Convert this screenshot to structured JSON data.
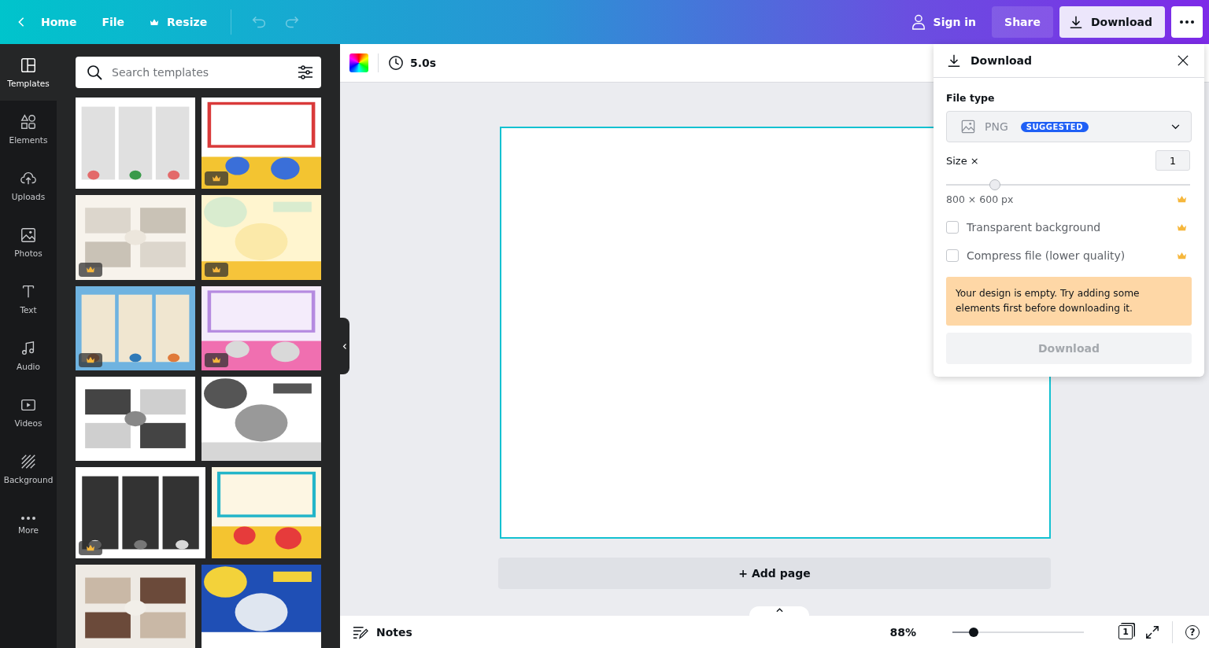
{
  "topbar": {
    "home": "Home",
    "file": "File",
    "resize": "Resize",
    "undo_disabled": true,
    "redo_disabled": true,
    "sign_in": "Sign in",
    "share": "Share",
    "download": "Download"
  },
  "sidebar": {
    "items": [
      {
        "label": "Templates",
        "selected": true
      },
      {
        "label": "Elements",
        "selected": false
      },
      {
        "label": "Uploads",
        "selected": false
      },
      {
        "label": "Photos",
        "selected": false
      },
      {
        "label": "Text",
        "selected": false
      },
      {
        "label": "Audio",
        "selected": false
      },
      {
        "label": "Videos",
        "selected": false
      },
      {
        "label": "Background",
        "selected": false
      },
      {
        "label": "More",
        "selected": false
      }
    ]
  },
  "templates_panel": {
    "search": {
      "placeholder": "Search templates"
    },
    "rows": [
      {
        "items": [
          {
            "kind": "picture",
            "premium": false
          },
          {
            "kind": "picture",
            "premium": true
          }
        ]
      },
      {
        "items": [
          {
            "kind": "picture",
            "premium": true
          },
          {
            "kind": "picture",
            "premium": true
          }
        ]
      },
      {
        "items": [
          {
            "kind": "picture",
            "premium": true
          },
          {
            "kind": "picture",
            "premium": true
          }
        ]
      },
      {
        "items": [
          {
            "kind": "picture",
            "premium": false
          },
          {
            "kind": "picture",
            "premium": false
          }
        ]
      },
      {
        "items": [
          {
            "kind": "picture",
            "premium": true
          },
          {
            "kind": "picture",
            "premium": false
          }
        ]
      },
      {
        "items": [
          {
            "kind": "picture",
            "premium": false
          },
          {
            "kind": "picture",
            "premium": false
          }
        ]
      }
    ]
  },
  "editor_toolbar": {
    "duration": "5.0s"
  },
  "canvas": {
    "add_page": "+ Add page"
  },
  "bottom_bar": {
    "notes": "Notes",
    "zoom": "88%",
    "zoom_slider": {
      "level": 0.16
    },
    "page_count": "1",
    "help": "?"
  },
  "download_panel": {
    "title": "Download",
    "file_type_label": "File type",
    "file_type": "PNG",
    "badge": "SUGGESTED",
    "size_label": "Size ×",
    "size_value": "1",
    "size_slider": {
      "level": 0.2
    },
    "dimensions": "800 × 600 px",
    "options": [
      {
        "label": "Transparent background",
        "checked": false
      },
      {
        "label": "Compress file (lower quality)",
        "checked": false
      }
    ],
    "warning": "Your design is empty. Try adding some elements first before downloading it.",
    "button": {
      "label": "Download",
      "disabled": true
    }
  }
}
